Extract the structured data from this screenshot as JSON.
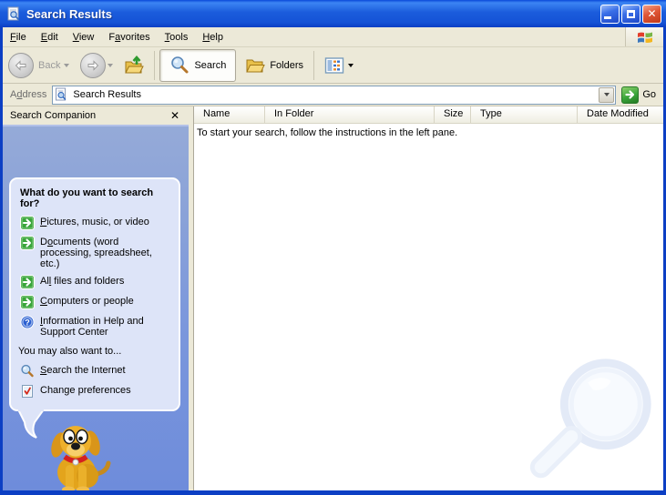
{
  "window": {
    "title": "Search Results"
  },
  "menu": {
    "items": [
      {
        "pre": "",
        "key": "F",
        "post": "ile"
      },
      {
        "pre": "",
        "key": "E",
        "post": "dit"
      },
      {
        "pre": "",
        "key": "V",
        "post": "iew"
      },
      {
        "pre": "F",
        "key": "a",
        "post": "vorites"
      },
      {
        "pre": "",
        "key": "T",
        "post": "ools"
      },
      {
        "pre": "",
        "key": "H",
        "post": "elp"
      }
    ]
  },
  "toolbar": {
    "back_label": "Back",
    "search_label": "Search",
    "folders_label": "Folders"
  },
  "address": {
    "label_pre": "A",
    "label_key": "d",
    "label_post": "dress",
    "value": "Search Results",
    "go_label": "Go"
  },
  "columns": {
    "name": "Name",
    "in_folder": "In Folder",
    "size": "Size",
    "type": "Type",
    "date_modified": "Date Modified"
  },
  "content": {
    "instruction": "To start your search, follow the instructions in the left pane."
  },
  "sidebar": {
    "header": "Search Companion",
    "question": "What do you want to search for?",
    "options": [
      {
        "pre": "",
        "key": "P",
        "post": "ictures, music, or video"
      },
      {
        "pre": "D",
        "key": "o",
        "post": "cuments (word processing, spreadsheet, etc.)"
      },
      {
        "pre": "Al",
        "key": "l",
        "post": " files and folders"
      },
      {
        "pre": "",
        "key": "C",
        "post": "omputers or people"
      },
      {
        "pre": "",
        "key": "I",
        "post": "nformation in Help and Support Center"
      }
    ],
    "also_heading": "You may also want to...",
    "also_options": [
      {
        "pre": "",
        "key": "S",
        "post": "earch the Internet"
      },
      {
        "pre": "",
        "key": "",
        "post": "Change preferences"
      }
    ]
  },
  "colors": {
    "titlebar_blue": "#1b5cdc",
    "pane_blue": "#7b97dc",
    "panel_bg": "#dde4f8",
    "chrome_beige": "#ece9d8",
    "accent_green": "#3aa53a",
    "close_red": "#d8492a"
  }
}
